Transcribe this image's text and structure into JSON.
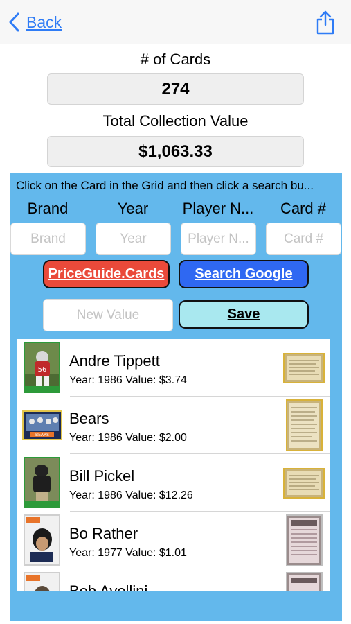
{
  "nav": {
    "back_label": "Back"
  },
  "stats": {
    "cards_label": "# of Cards",
    "cards_value": "274",
    "total_label": "Total Collection Value",
    "total_value": "$1,063.33"
  },
  "search_panel": {
    "instruction": "Click on the Card in the Grid and then click a search bu...",
    "headers": [
      "Brand",
      "Year",
      "Player N...",
      "Card #"
    ],
    "placeholders": [
      "Brand",
      "Year",
      "Player N...",
      "Card #"
    ],
    "priceguide_label": "PriceGuide.Cards",
    "google_label": "Search Google",
    "new_value_placeholder": "New Value",
    "save_label": "Save",
    "panel_color": "#63b8ec"
  },
  "cards": [
    {
      "name": "Andre Tippett",
      "detail": "Year: 1986 Value: $3.74"
    },
    {
      "name": "Bears",
      "detail": "Year: 1986 Value: $2.00"
    },
    {
      "name": "Bill Pickel",
      "detail": "Year: 1986 Value: $12.26"
    },
    {
      "name": "Bo Rather",
      "detail": "Year: 1977 Value: $1.01"
    },
    {
      "name": "Bob Avellini",
      "detail": ""
    }
  ],
  "colors": {
    "accent_blue": "#2f7cf6",
    "priceguide_red": "#ea4a3a",
    "google_blue": "#2f68f2",
    "save_cyan": "#a9e8ef"
  }
}
